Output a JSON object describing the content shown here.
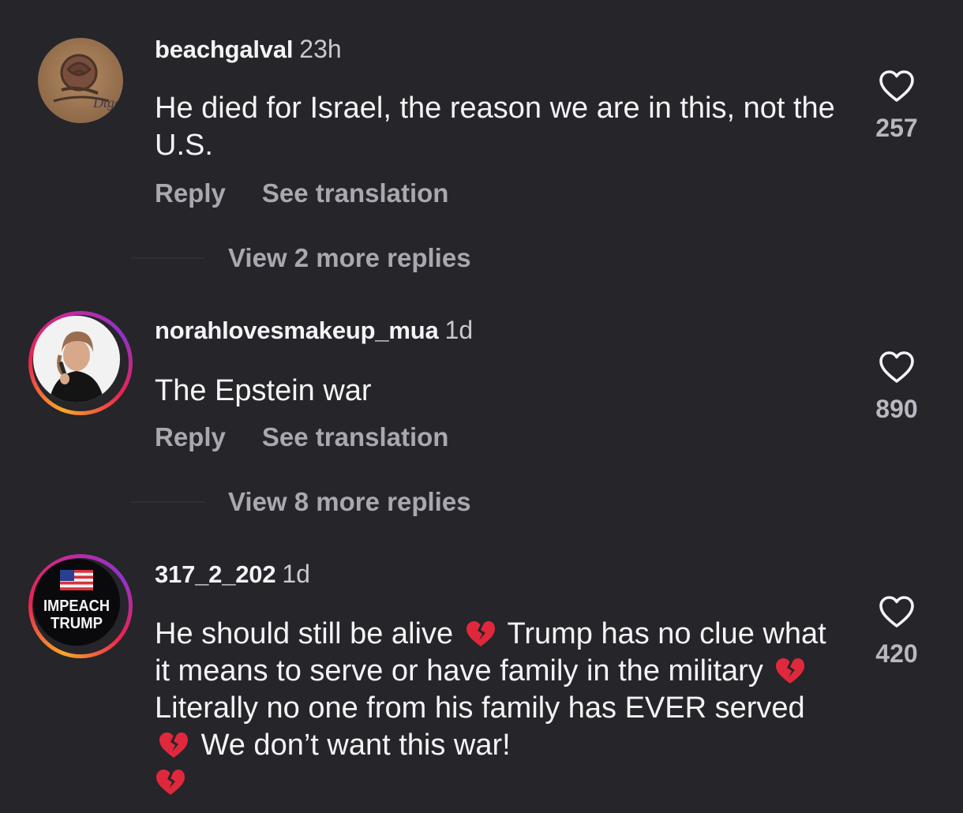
{
  "comments": [
    {
      "username": "beachgalval",
      "time": "23h",
      "text": "He died for Israel, the reason we are in this, not the U.S.",
      "reply_label": "Reply",
      "translate_label": "See translation",
      "view_replies": "View 2 more replies",
      "likes": "257",
      "avatar": "rose-tattoo-avatar"
    },
    {
      "username": "norahlovesmakeup_mua",
      "time": "1d",
      "text": "The Epstein war",
      "reply_label": "Reply",
      "translate_label": "See translation",
      "view_replies": "View 8 more replies",
      "likes": "890",
      "avatar": "woman-portrait-avatar",
      "story_ring": true
    },
    {
      "username": "317_2_202",
      "time": "1d",
      "text_parts": [
        "He should still be alive",
        "Trump has no clue what it means to serve or have family in the military",
        "Literally no one from his family has EVER served",
        "We don’t want this war!"
      ],
      "emoji": "broken-heart-icon",
      "likes": "420",
      "avatar": "impeach-trump-avatar",
      "avatar_text": [
        "IMPEACH",
        "TRUMP"
      ],
      "story_ring": true
    }
  ],
  "colors": {
    "background": "#25252a",
    "text": "#f4f4f6",
    "muted": "#a8a8b0",
    "broken_heart": "#e0283c"
  }
}
